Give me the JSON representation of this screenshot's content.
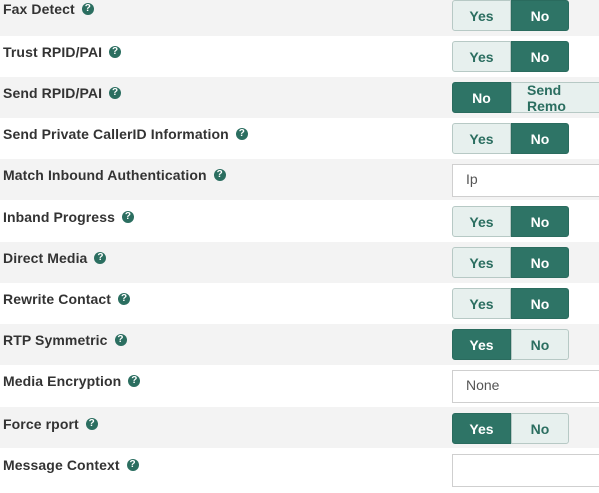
{
  "settings": [
    {
      "label": "Fax Detect",
      "yes": "Yes",
      "no": "No",
      "selected": "No"
    },
    {
      "label": "Trust RPID/PAI",
      "yes": "Yes",
      "no": "No",
      "selected": "No"
    },
    {
      "label": "Send RPID/PAI",
      "no": "No",
      "send_remote": "Send Remo",
      "selected": "No"
    },
    {
      "label": "Send Private CallerID Information",
      "yes": "Yes",
      "no": "No",
      "selected": "No"
    },
    {
      "label": "Match Inbound Authentication",
      "value": "Ip"
    },
    {
      "label": "Inband Progress",
      "yes": "Yes",
      "no": "No",
      "selected": "No"
    },
    {
      "label": "Direct Media",
      "yes": "Yes",
      "no": "No",
      "selected": "No"
    },
    {
      "label": "Rewrite Contact",
      "yes": "Yes",
      "no": "No",
      "selected": "No"
    },
    {
      "label": "RTP Symmetric",
      "yes": "Yes",
      "no": "No",
      "selected": "Yes"
    },
    {
      "label": "Media Encryption",
      "value": "None"
    },
    {
      "label": "Force rport",
      "yes": "Yes",
      "no": "No",
      "selected": "Yes"
    },
    {
      "label": "Message Context",
      "value": ""
    }
  ],
  "help_icon": {
    "name": "question-circle-icon",
    "glyph": "?",
    "color": "#2b6e60"
  },
  "colors": {
    "active": "#2e7466",
    "inactive_bg": "#e7f0ee",
    "row_alt": "#f3f3f3"
  }
}
